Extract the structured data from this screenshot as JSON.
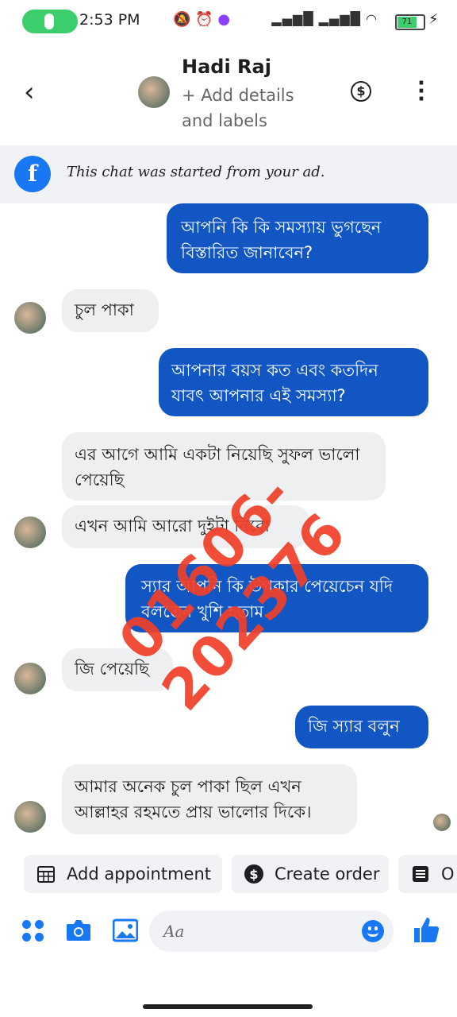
{
  "status_bar": {
    "time": "2:53 PM",
    "battery": "71"
  },
  "header": {
    "contact_name": "Hadi Raj",
    "add_details": "+ Add details and labels"
  },
  "banner": {
    "text": "This chat was started from your ad."
  },
  "messages": [
    {
      "dir": "out",
      "text": "আপনি কি কি সমস্যায় ভুগছেন বিস্তারিত জানাবেন?"
    },
    {
      "dir": "in",
      "text": "চুল পাকা"
    },
    {
      "dir": "out",
      "text": "আপনার বয়স কত এবং কতদিন যাবৎ আপনার এই সমস্যা?"
    },
    {
      "dir": "in",
      "text": "এর আগে আমি একটা নিয়েছি সুফল ভালো পেয়েছি"
    },
    {
      "dir": "in",
      "text": "এখন আমি আরো দুইটা নিবো"
    },
    {
      "dir": "out",
      "text": "স্যার আপনি কি উপকার পেয়েচেন যদি বলতেন খুশি হতাম"
    },
    {
      "dir": "in",
      "text": "জি পেয়েছি"
    },
    {
      "dir": "out",
      "text": "জি স্যার বলুন"
    },
    {
      "dir": "in",
      "text": "আমার অনেক চুল পাকা ছিল এখন আল্লাহর রহমতে প্রায় ভালোর দিকে।"
    }
  ],
  "watermark": "01606-202376",
  "quick_actions": [
    {
      "label": "Add appointment",
      "icon": "calendar-icon"
    },
    {
      "label": "Create order",
      "icon": "dollar-circle-icon"
    },
    {
      "label": "O",
      "icon": "order-list-icon"
    }
  ],
  "composer": {
    "placeholder": "Aa"
  },
  "colors": {
    "outgoing_bubble": "#1256c4",
    "incoming_bubble": "#eeeff1",
    "accent": "#1877f2",
    "watermark": "#f0402b"
  }
}
